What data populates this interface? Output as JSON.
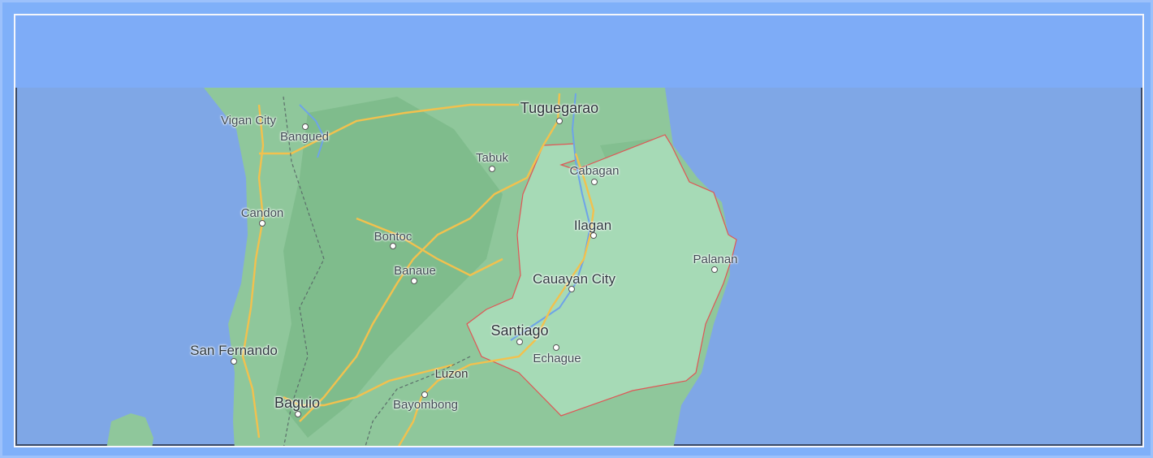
{
  "map": {
    "places": [
      {
        "name": "Tuguegarao",
        "size": "big"
      },
      {
        "name": "Vigan City",
        "size": "small"
      },
      {
        "name": "Bangued",
        "size": "small"
      },
      {
        "name": "Tabuk",
        "size": "small"
      },
      {
        "name": "Cabagan",
        "size": "small"
      },
      {
        "name": "Candon",
        "size": "small"
      },
      {
        "name": "Ilagan",
        "size": "med"
      },
      {
        "name": "Bontoc",
        "size": "small"
      },
      {
        "name": "Palanan",
        "size": "small"
      },
      {
        "name": "Banaue",
        "size": "small"
      },
      {
        "name": "Cauayan City",
        "size": "med"
      },
      {
        "name": "Santiago",
        "size": "big"
      },
      {
        "name": "San Fernando",
        "size": "med"
      },
      {
        "name": "Echague",
        "size": "small"
      },
      {
        "name": "Luzon",
        "size": "small"
      },
      {
        "name": "Baguio",
        "size": "big"
      },
      {
        "name": "Bayombong",
        "size": "small"
      }
    ],
    "colors": {
      "water": "#7fa7e6",
      "land": "#8fc79b",
      "highlight_region": "#a6dab6",
      "region_border": "#e05555",
      "roads": "#f2c14e"
    }
  }
}
